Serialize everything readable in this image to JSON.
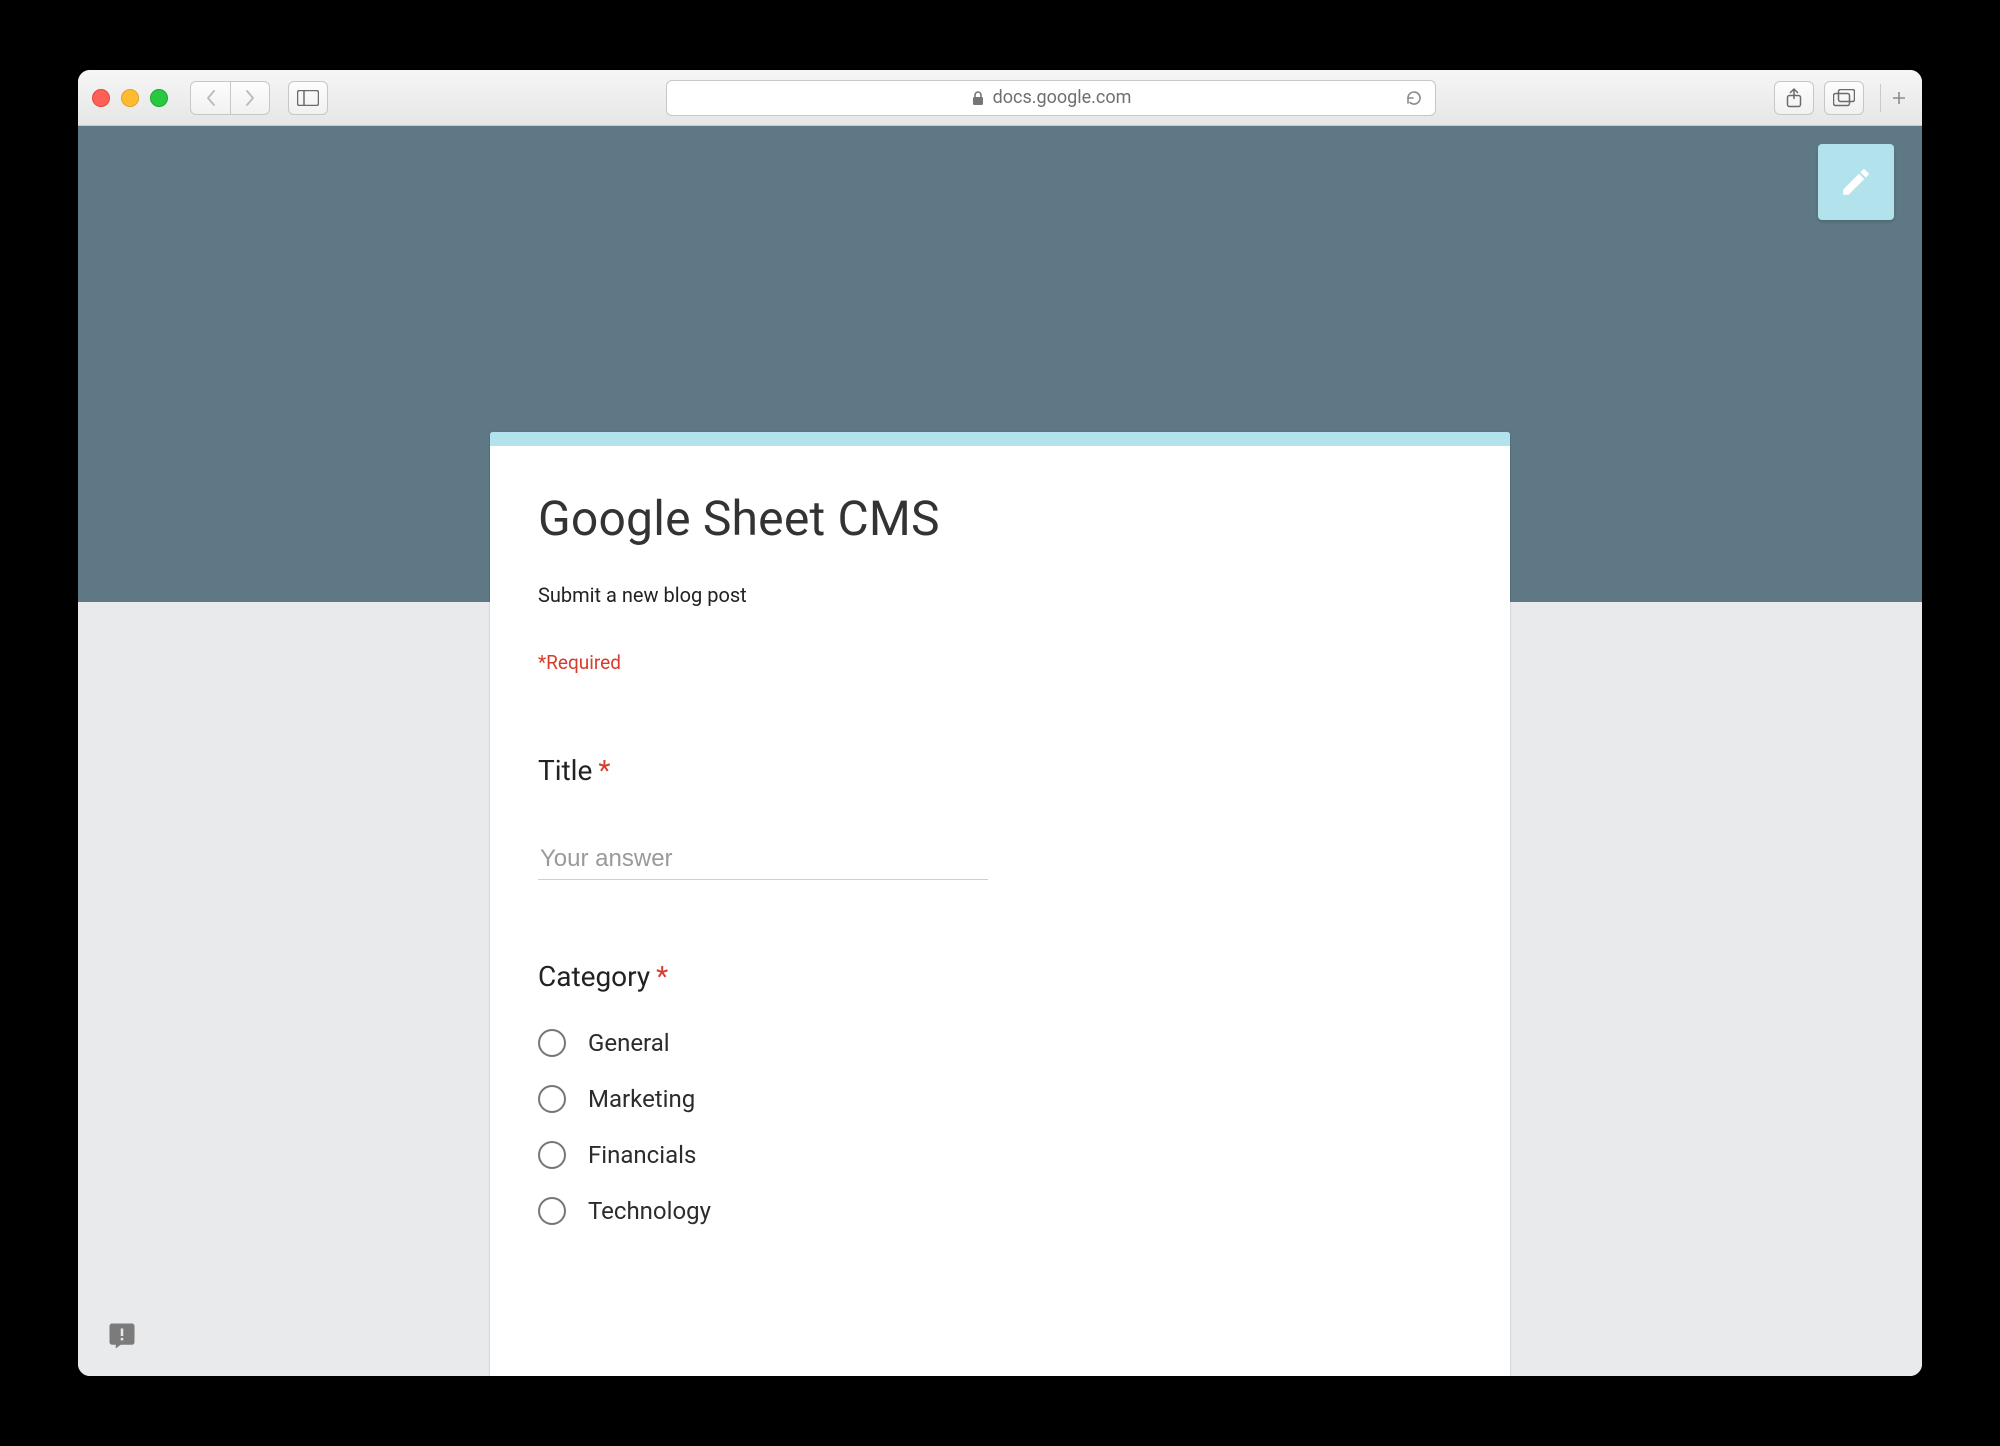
{
  "browser": {
    "url_host": "docs.google.com"
  },
  "form": {
    "title": "Google Sheet CMS",
    "description": "Submit a new blog post",
    "required_note": "*Required",
    "title_field": {
      "label": "Title",
      "placeholder": "Your answer"
    },
    "category_field": {
      "label": "Category",
      "options": [
        "General",
        "Marketing",
        "Financials",
        "Technology"
      ]
    }
  }
}
